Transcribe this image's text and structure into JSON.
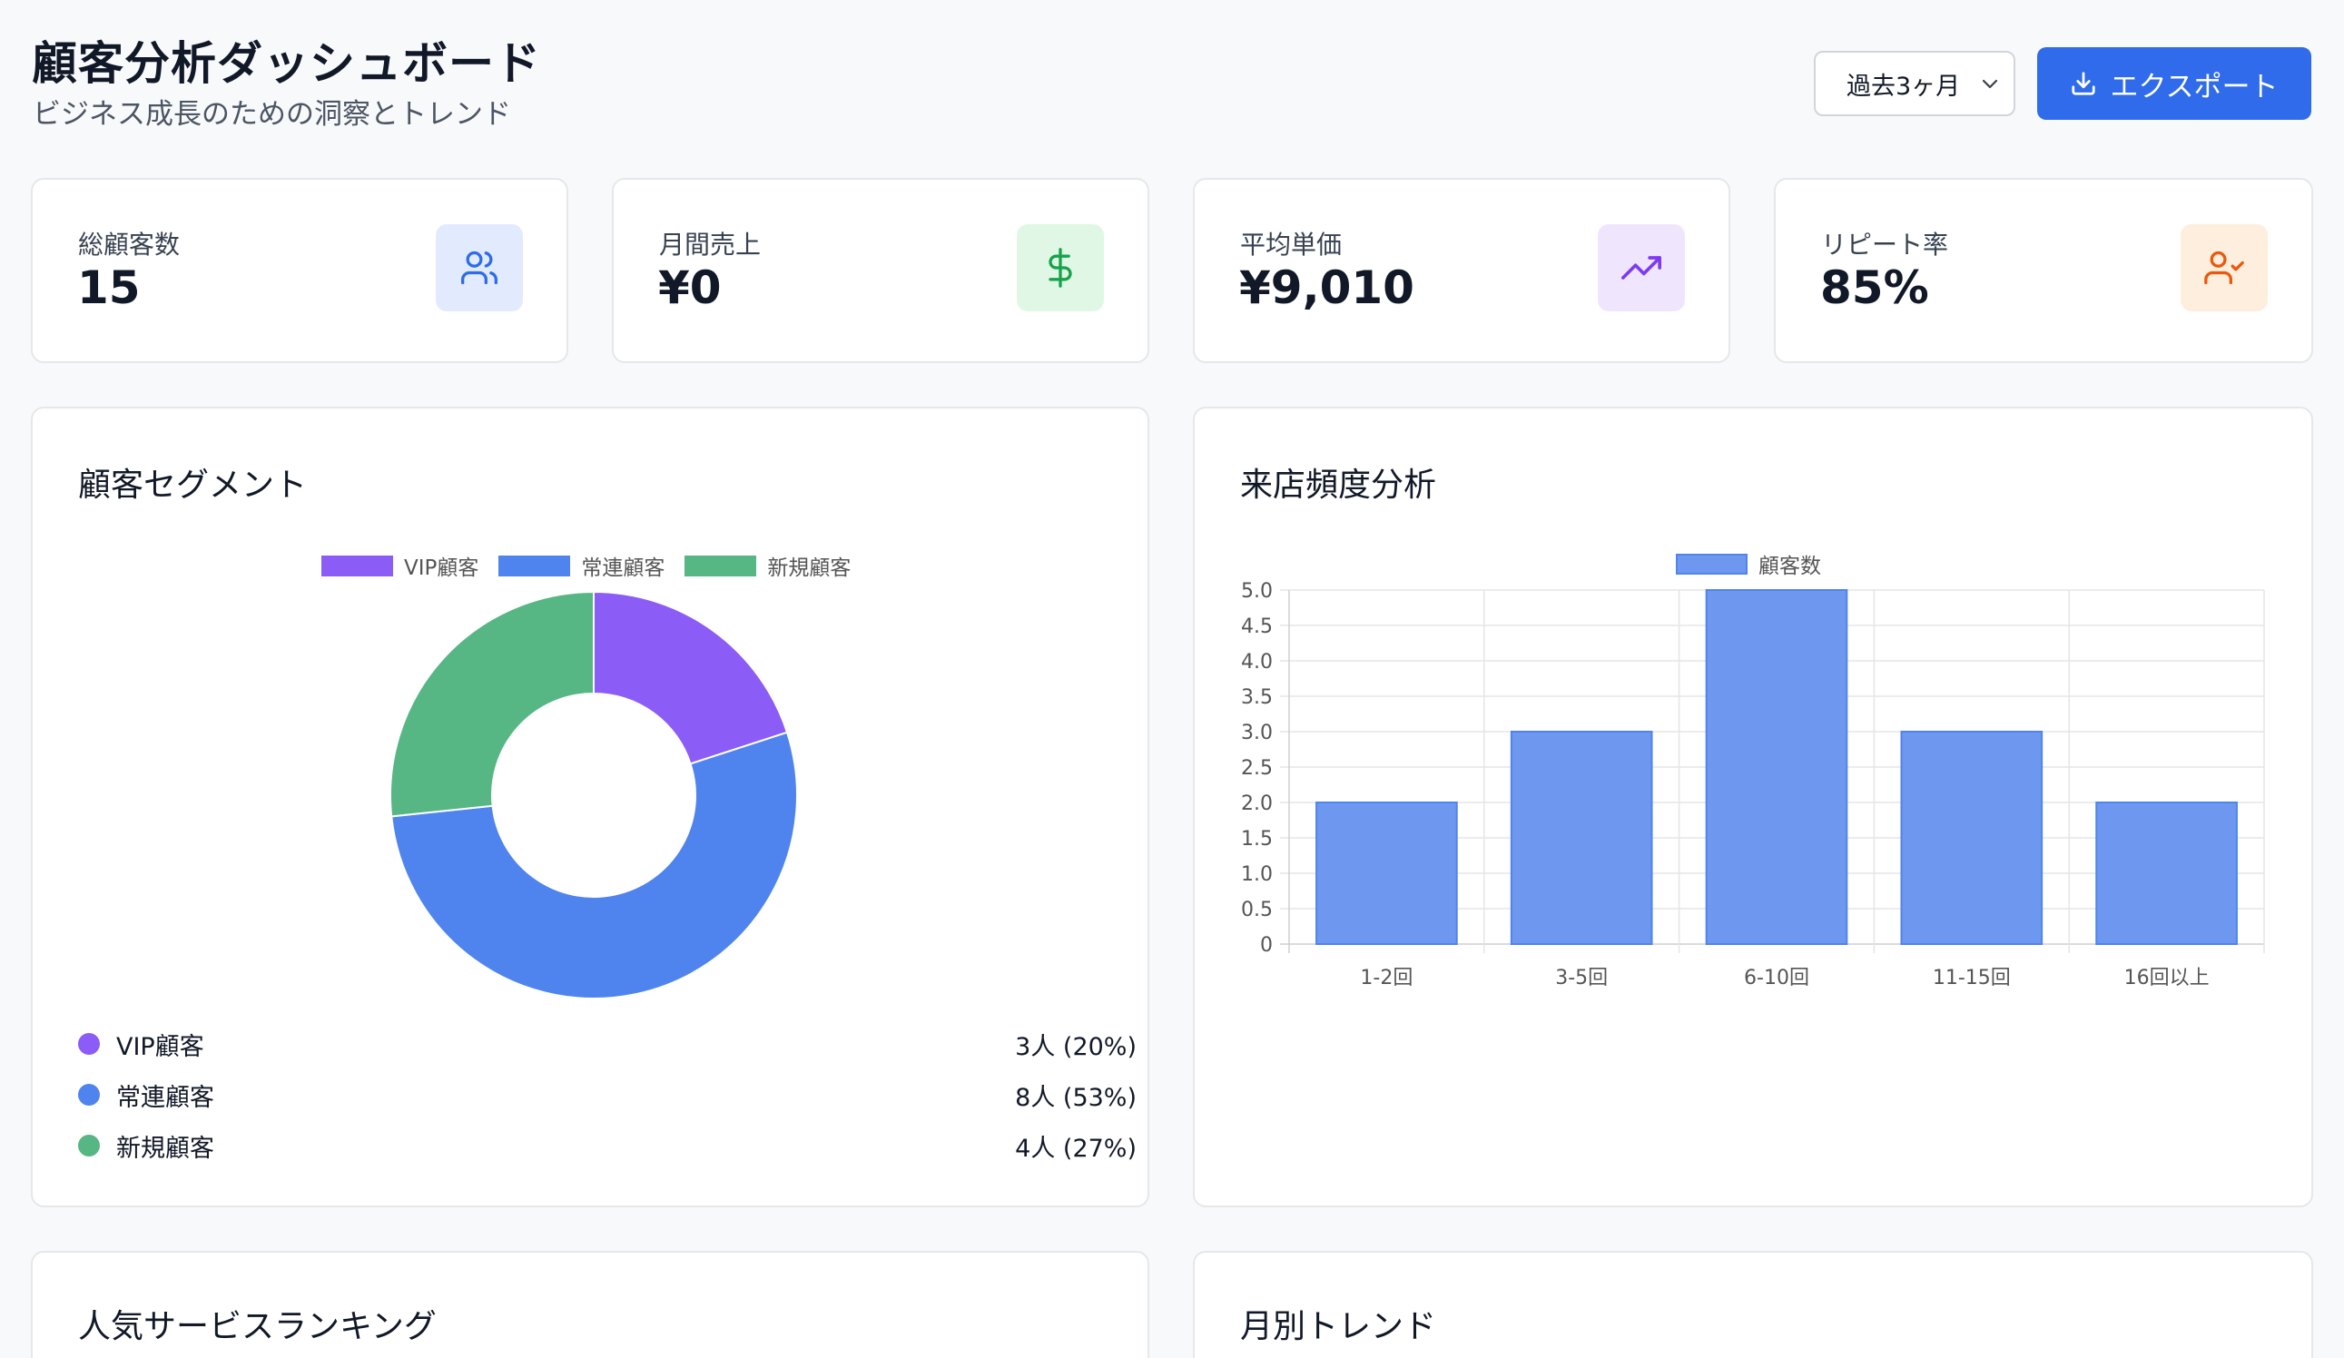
{
  "header": {
    "title": "顧客分析ダッシュボード",
    "subtitle": "ビジネス成長のための洞察とトレンド",
    "period_select": "過去3ヶ月",
    "export_label": "エクスポート"
  },
  "kpis": [
    {
      "label": "総顧客数",
      "value": "15",
      "icon": "users-icon",
      "color": "#2f6bea",
      "bg": "#e1ebfd"
    },
    {
      "label": "月間売上",
      "value": "¥0",
      "icon": "dollar-icon",
      "color": "#16a34a",
      "bg": "#e1f7e6"
    },
    {
      "label": "平均単価",
      "value": "¥9,010",
      "icon": "trending-up-icon",
      "color": "#7e3af2",
      "bg": "#efe6fd"
    },
    {
      "label": "リピート率",
      "value": "85%",
      "icon": "user-check-icon",
      "color": "#ea580c",
      "bg": "#fdeede"
    }
  ],
  "segments_section": {
    "title": "顧客セグメント",
    "items": [
      {
        "name": "VIP顧客",
        "value": "3人 (20%)",
        "count": 3,
        "color": "#8b5cf6"
      },
      {
        "name": "常連顧客",
        "value": "8人 (53%)",
        "count": 8,
        "color": "#4f84ee"
      },
      {
        "name": "新規顧客",
        "value": "4人 (27%)",
        "count": 4,
        "color": "#56b684"
      }
    ]
  },
  "frequency_section": {
    "title": "来店頻度分析"
  },
  "ranking_section": {
    "title": "人気サービスランキング"
  },
  "trend_section": {
    "title": "月別トレンド"
  },
  "chart_data": [
    {
      "type": "pie",
      "title": "",
      "categories": [
        "VIP顧客",
        "常連顧客",
        "新規顧客"
      ],
      "values": [
        3,
        8,
        4
      ],
      "colors": [
        "#8b5cf6",
        "#4f84ee",
        "#56b684"
      ],
      "legend": "top"
    },
    {
      "type": "bar",
      "title": "",
      "categories": [
        "1-2回",
        "3-5回",
        "6-10回",
        "11-15回",
        "16回以上"
      ],
      "series": [
        {
          "name": "顧客数",
          "values": [
            2,
            3,
            5,
            3,
            2
          ]
        }
      ],
      "ylim": [
        0,
        5
      ],
      "yticks": [
        "0",
        "0.5",
        "1.0",
        "1.5",
        "2.0",
        "2.5",
        "3.0",
        "3.5",
        "4.0",
        "4.5",
        "5.0"
      ],
      "grid": true,
      "legend": "top",
      "color": "#6e98f0"
    }
  ]
}
